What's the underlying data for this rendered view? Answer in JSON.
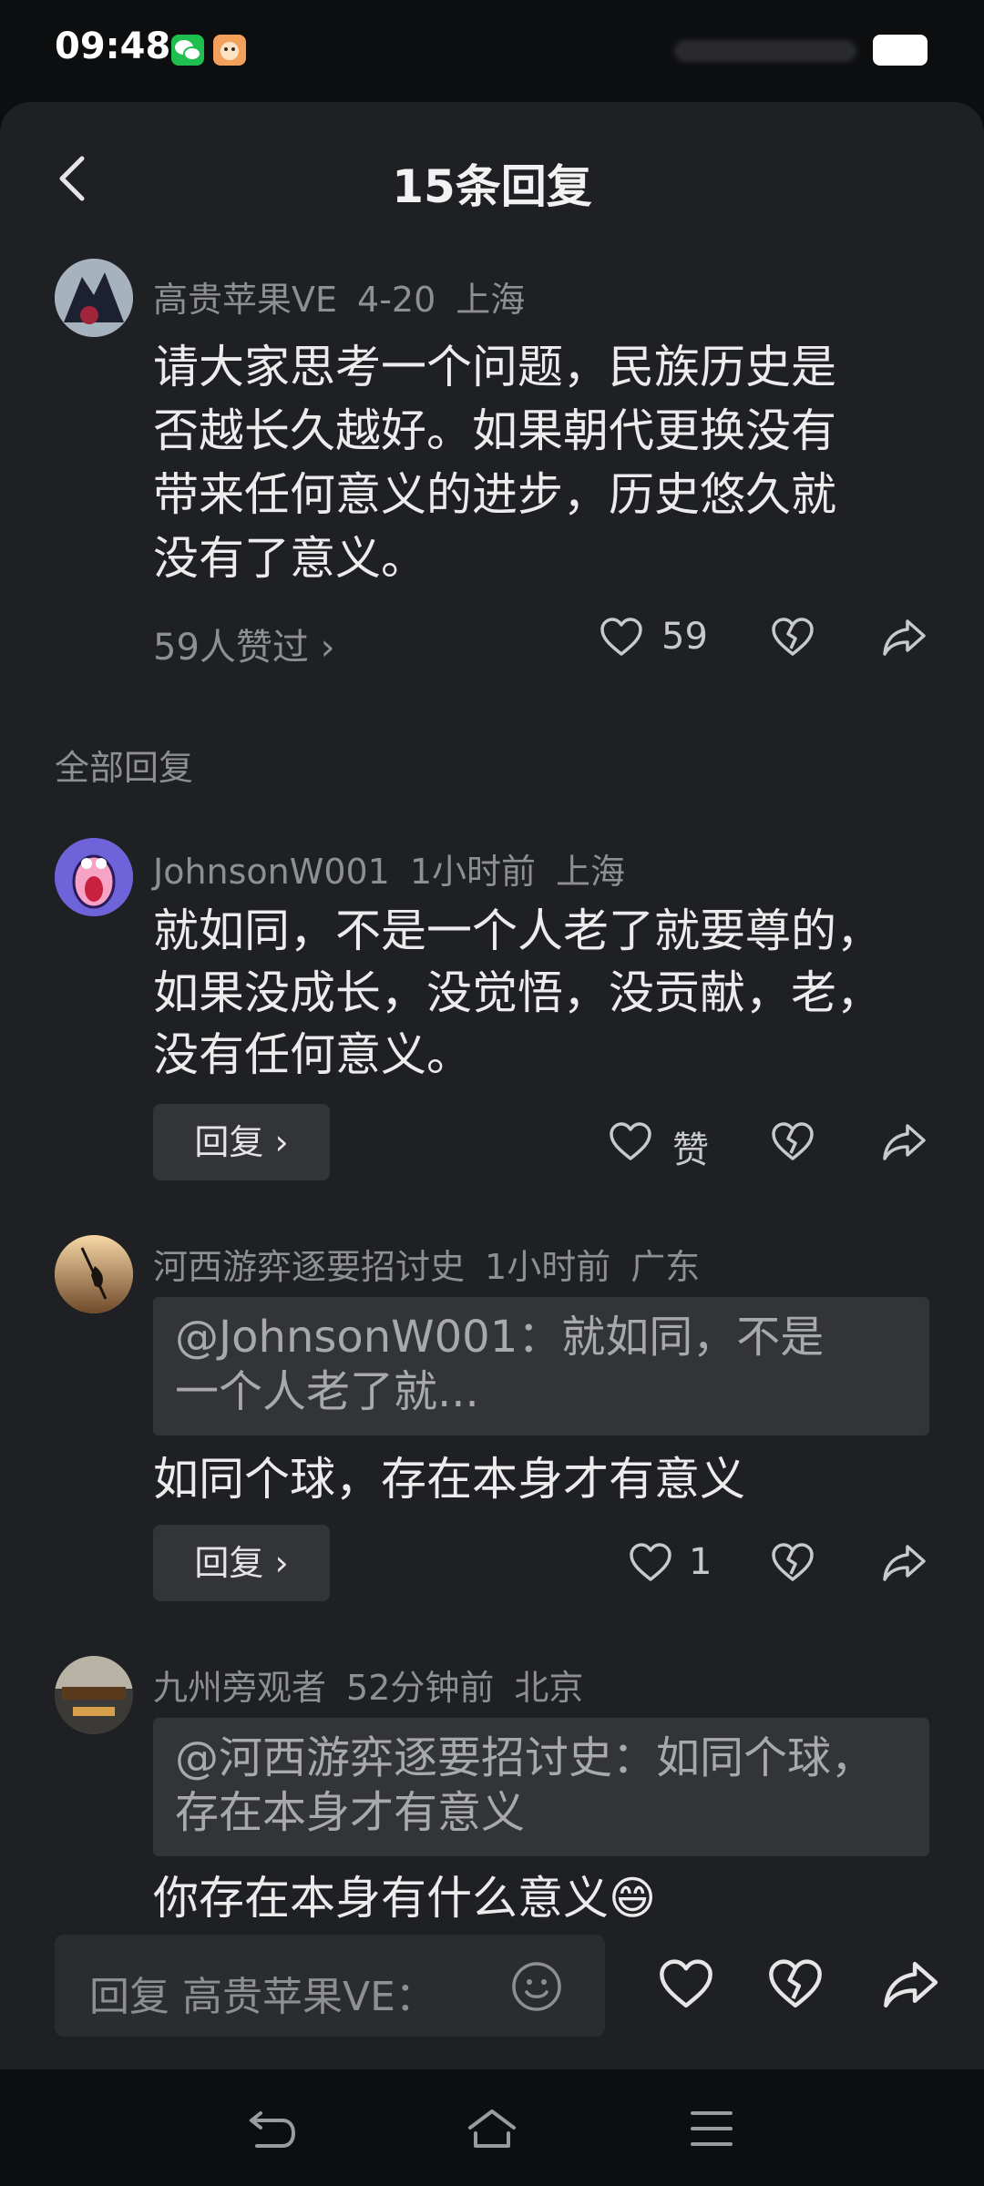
{
  "status": {
    "time": "09:48",
    "icons": [
      "wechat-icon",
      "app-notification-icon"
    ],
    "battery": "battery-icon"
  },
  "header": {
    "title": "15条回复"
  },
  "main_comment": {
    "author": "高贵苹果VE",
    "date": "4-20",
    "location": "上海",
    "text_lines": [
      "请大家思考一个问题，民族历史是",
      "否越长久越好。如果朝代更换没有",
      "带来任何意义的进步，历史悠久就",
      "没有了意义。"
    ],
    "likes_link": "59人赞过 ›",
    "like_count": "59"
  },
  "section_title": "全部回复",
  "replies": [
    {
      "author": "JohnsonW001",
      "time": "1小时前",
      "location": "上海",
      "text_lines": [
        "就如同，不是一个人老了就要尊的，",
        "如果没成长，没觉悟，没贡献，老，",
        "没有任何意义。"
      ],
      "reply_label": "回复 ›",
      "like_label": "赞"
    },
    {
      "author": "河西游弈逐要招讨史",
      "time": "1小时前",
      "location": "广东",
      "quote_lines": [
        "@JohnsonW001：就如同，不是",
        "一个人老了就..."
      ],
      "text": "如同个球，存在本身才有意义",
      "reply_label": "回复 ›",
      "like_label": "1"
    },
    {
      "author": "九州旁观者",
      "time": "52分钟前",
      "location": "北京",
      "quote_lines": [
        "@河西游弈逐要招讨史：如同个球，",
        "存在本身才有意义"
      ],
      "text": "你存在本身有什么意义😄"
    }
  ],
  "input": {
    "placeholder": "回复 高贵苹果VE："
  },
  "colors": {
    "background": "#1f2023",
    "statusbar": "#0d0e10",
    "bubble": "#333437",
    "meta": "#8e8f93",
    "text": "#ececed"
  }
}
